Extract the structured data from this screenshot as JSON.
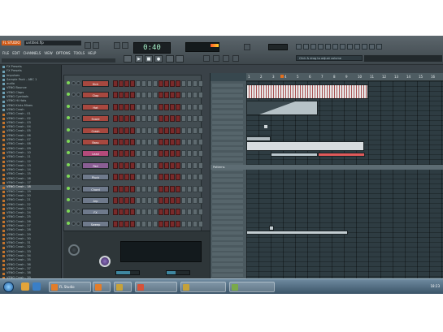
{
  "toolbar": {
    "logo": "FL STUDIO",
    "song_name": "untitled.flp",
    "menus": [
      "FILE",
      "EDIT",
      "CHANNELS",
      "VIEW",
      "OPTIONS",
      "TOOLS",
      "HELP"
    ],
    "status_line": "",
    "time": "0:40",
    "hint": "Click & drag to adjust volume"
  },
  "browser": {
    "items": [
      {
        "label": "FX Presets",
        "type": "folder"
      },
      {
        "label": "FX Presets",
        "type": "folder"
      },
      {
        "label": "Impulses",
        "type": "folder"
      },
      {
        "label": "Sample Pack - ABC 1",
        "type": "folder"
      },
      {
        "label": "audio",
        "type": "folder"
      },
      {
        "label": "VENG Bounce",
        "type": "folder"
      },
      {
        "label": "VENG Claps",
        "type": "folder"
      },
      {
        "label": "VENG Cymbals",
        "type": "folder"
      },
      {
        "label": "VENG Hi Hats",
        "type": "folder"
      },
      {
        "label": "VENG Kicks Mixes",
        "type": "folder"
      },
      {
        "label": "VENG Crash",
        "type": "folder"
      },
      {
        "label": "VENG Crash - 01",
        "type": "file"
      },
      {
        "label": "VENG Crash - 02",
        "type": "file"
      },
      {
        "label": "VENG Crash - 03",
        "type": "file"
      },
      {
        "label": "VENG Crash - 04",
        "type": "file"
      },
      {
        "label": "VENG Crash - 05",
        "type": "file"
      },
      {
        "label": "VENG Crash - 06",
        "type": "file"
      },
      {
        "label": "VENG Crash - 07",
        "type": "file"
      },
      {
        "label": "VENG Crash - 08",
        "type": "file"
      },
      {
        "label": "VENG Crash - 09",
        "type": "file"
      },
      {
        "label": "VENG Crash - 10",
        "type": "file"
      },
      {
        "label": "VENG Crash - 11",
        "type": "file"
      },
      {
        "label": "VENG Crash - 12",
        "type": "file"
      },
      {
        "label": "VENG Crash - 13",
        "type": "file"
      },
      {
        "label": "VENG Crash - 14",
        "type": "file"
      },
      {
        "label": "VENG Crash - 15",
        "type": "file"
      },
      {
        "label": "VENG Crash - 16",
        "type": "file"
      },
      {
        "label": "VENG Crash - 17",
        "type": "file"
      },
      {
        "label": "VENG Crash - 18",
        "type": "file",
        "selected": true
      },
      {
        "label": "VENG Crash - 19",
        "type": "file"
      },
      {
        "label": "VENG Crash - 20",
        "type": "file"
      },
      {
        "label": "VENG Crash - 21",
        "type": "file"
      },
      {
        "label": "VENG Crash - 22",
        "type": "file"
      },
      {
        "label": "VENG Crash - 23",
        "type": "file"
      },
      {
        "label": "VENG Crash - 24",
        "type": "file"
      },
      {
        "label": "VENG Crash - 25",
        "type": "file"
      },
      {
        "label": "VENG Crash - 26",
        "type": "file"
      },
      {
        "label": "VENG Crash - 27",
        "type": "file"
      },
      {
        "label": "VENG Crash - 28",
        "type": "file"
      },
      {
        "label": "VENG Crash - 29",
        "type": "file"
      },
      {
        "label": "VENG Crash - 30",
        "type": "file"
      },
      {
        "label": "VENG Crash - 31",
        "type": "file"
      },
      {
        "label": "VENG Crash - 32",
        "type": "file"
      },
      {
        "label": "VENG Crash - 33",
        "type": "file"
      },
      {
        "label": "VENG Crash - 34",
        "type": "file"
      },
      {
        "label": "VENG Crash - 35",
        "type": "file"
      },
      {
        "label": "VENG Crash - 36",
        "type": "file"
      },
      {
        "label": "VENG Crash - 37",
        "type": "file"
      },
      {
        "label": "VENG Crash - 38",
        "type": "file"
      },
      {
        "label": "VENG Crash - 39",
        "type": "file"
      },
      {
        "label": "VENG Sync Effects",
        "type": "folder"
      },
      {
        "label": "VENG Build-Ups & Fills",
        "type": "folder"
      }
    ]
  },
  "rack": {
    "channels": [
      {
        "name": "Kick",
        "color": "#a8483f"
      },
      {
        "name": "Clap",
        "color": "#a8483f"
      },
      {
        "name": "Hat",
        "color": "#a8483f"
      },
      {
        "name": "Snare",
        "color": "#a8483f"
      },
      {
        "name": "Crash",
        "color": "#a8483f"
      },
      {
        "name": "Bass",
        "color": "#a8483f"
      },
      {
        "name": "Lead",
        "color": "#b54a7a"
      },
      {
        "name": "Pad",
        "color": "#8a5e94"
      },
      {
        "name": "Pluck",
        "color": "#6f7a8c"
      },
      {
        "name": "Chord",
        "color": "#6f7a8c"
      },
      {
        "name": "Arp",
        "color": "#6f7a8c"
      },
      {
        "name": "FX",
        "color": "#6f7a8c"
      },
      {
        "name": "Sweep",
        "color": "#6f7a8c"
      },
      {
        "name": "Vocal",
        "color": "#5f8f3c"
      },
      {
        "name": "Sub",
        "color": "#b44a3a"
      },
      {
        "name": "Riser",
        "color": "#b86040"
      }
    ]
  },
  "mixer": {
    "display_text": "",
    "insert_label": "Insert",
    "master_label": "Master"
  },
  "playlist": {
    "track_header": "Pattern 1",
    "section_label": "Patterns",
    "ruler": [
      "1",
      "2",
      "3",
      "4",
      "5",
      "6",
      "7",
      "8",
      "9",
      "10",
      "11",
      "12",
      "13",
      "14",
      "15",
      "16"
    ]
  },
  "taskbar": {
    "buttons": [
      "FL Studio",
      "FL Studio",
      "Explorer",
      "Folder"
    ],
    "clock": "18:23"
  }
}
